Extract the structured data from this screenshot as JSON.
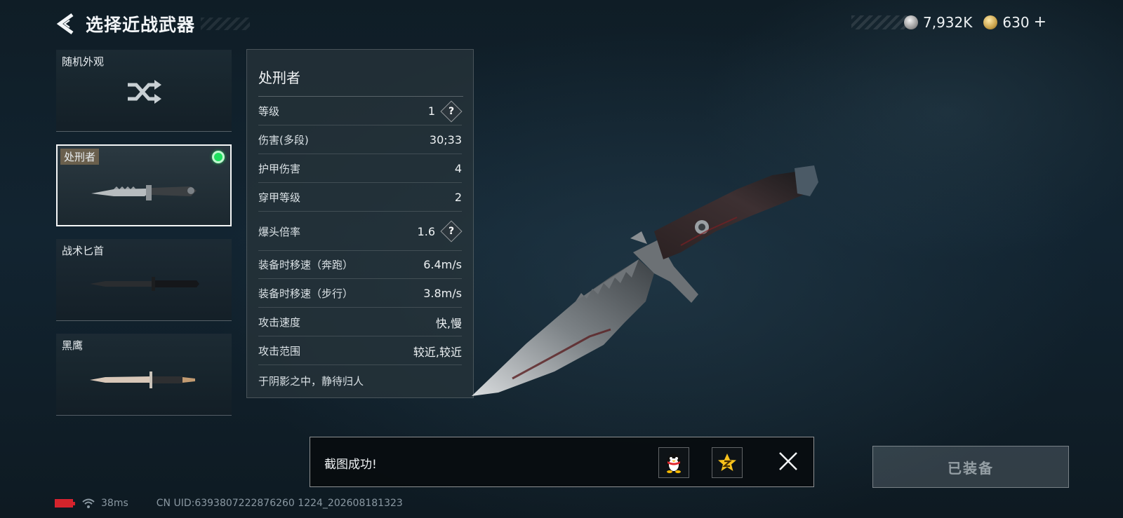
{
  "header": {
    "title": "选择近战武器"
  },
  "currency": {
    "silver": "7,932K",
    "gold": "630",
    "plus": "+"
  },
  "weapons": [
    {
      "label": "随机外观"
    },
    {
      "label": "处刑者"
    },
    {
      "label": "战术匕首"
    },
    {
      "label": "黑鹰"
    }
  ],
  "stats": {
    "name": "处刑者",
    "rows": [
      {
        "label": "等级",
        "value": "1"
      },
      {
        "label": "伤害(多段)",
        "value": "30;33"
      },
      {
        "label": "护甲伤害",
        "value": "4"
      },
      {
        "label": "穿甲等级",
        "value": "2"
      },
      {
        "label": "爆头倍率",
        "value": "1.6"
      },
      {
        "label": "装备时移速（奔跑）",
        "value": "6.4m/s"
      },
      {
        "label": "装备时移速（步行）",
        "value": "3.8m/s"
      },
      {
        "label": "攻击速度",
        "value": "快,慢"
      },
      {
        "label": "攻击范围",
        "value": "较近,较近"
      }
    ],
    "qmark": "?",
    "description": "于阴影之中，静待归人"
  },
  "toast": {
    "message": "截图成功!"
  },
  "equipped_button": "已装备",
  "status": {
    "ping": "38ms",
    "uid": "CN UID:6393807222876260 1224_202608181323"
  },
  "colors": {
    "equipped_dot": "#1ee05e",
    "battery": "#d3242b"
  }
}
